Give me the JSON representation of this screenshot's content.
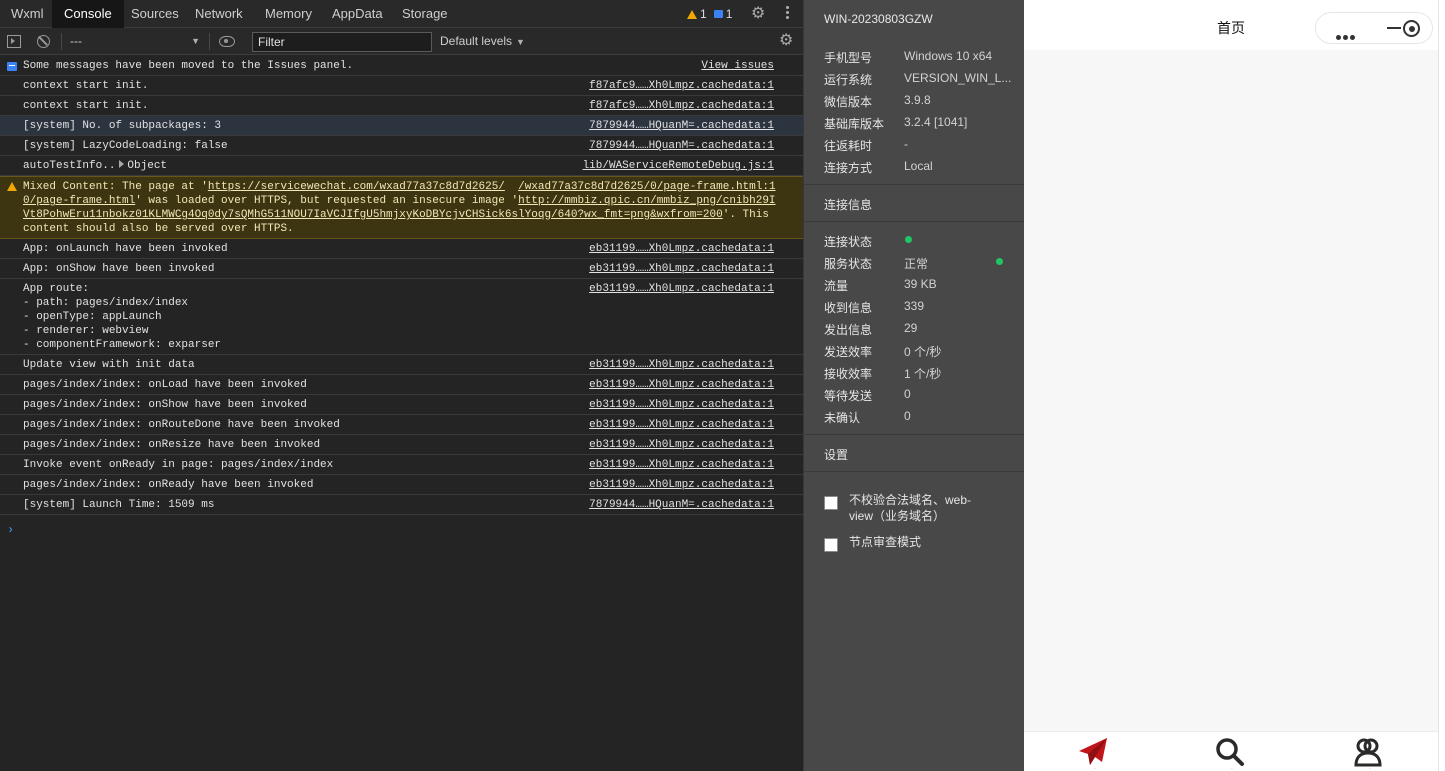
{
  "devtools": {
    "tabs": [
      "Wxml",
      "Console",
      "Sources",
      "Network",
      "Memory",
      "AppData",
      "Storage"
    ],
    "active_tab": "Console",
    "warning_count": "1",
    "message_count": "1",
    "toolbar": {
      "context": "---",
      "filter_placeholder": "Filter",
      "levels": "Default levels"
    },
    "console": {
      "issues_notice": "Some messages have been moved to the Issues panel.",
      "view_issues": "View issues",
      "rows": [
        {
          "text": "context start init.",
          "src": "f87afc9……Xh0Lmpz.cachedata:1"
        },
        {
          "text": "context start init.",
          "src": "f87afc9……Xh0Lmpz.cachedata:1"
        },
        {
          "text": "[system] No. of subpackages: 3",
          "src": "7879944……HQuanM=.cachedata:1"
        },
        {
          "text": "[system] LazyCodeLoading: false",
          "src": "7879944……HQuanM=.cachedata:1"
        },
        {
          "text": "autoTestInfo..",
          "obj": "Object",
          "src": "lib/WAServiceRemoteDebug.js:1"
        },
        {
          "text": "App: onLaunch have been invoked",
          "src": "eb31199……Xh0Lmpz.cachedata:1"
        },
        {
          "text": "App: onShow have been invoked",
          "src": "eb31199……Xh0Lmpz.cachedata:1"
        },
        {
          "text": "App route:\n- path: pages/index/index\n- openType: appLaunch\n- renderer: webview\n- componentFramework: exparser",
          "src": "eb31199……Xh0Lmpz.cachedata:1"
        },
        {
          "text": "Update view with init data",
          "src": "eb31199……Xh0Lmpz.cachedata:1"
        },
        {
          "text": "pages/index/index: onLoad have been invoked",
          "src": "eb31199……Xh0Lmpz.cachedata:1"
        },
        {
          "text": "pages/index/index: onShow have been invoked",
          "src": "eb31199……Xh0Lmpz.cachedata:1"
        },
        {
          "text": "pages/index/index: onRouteDone have been invoked",
          "src": "eb31199……Xh0Lmpz.cachedata:1"
        },
        {
          "text": "pages/index/index: onResize have been invoked",
          "src": "eb31199……Xh0Lmpz.cachedata:1"
        },
        {
          "text": "Invoke event onReady in page: pages/index/index",
          "src": "eb31199……Xh0Lmpz.cachedata:1"
        },
        {
          "text": "pages/index/index: onReady have been invoked",
          "src": "eb31199……Xh0Lmpz.cachedata:1"
        },
        {
          "text": "[system] Launch Time: 1509 ms",
          "src": "7879944……HQuanM=.cachedata:1"
        }
      ],
      "warning": {
        "a": "Mixed Content: The page at '",
        "url1": "https://servicewechat.com/wxad77a37c8d7d2625/",
        "gap": "  ",
        "src_line1": "/wxad77a37c8d7d2625/0/page-frame.html:1",
        "src_line2": "0/page-frame.html",
        "b": "' was loaded over HTTPS, but requested an insecure image '",
        "url2a": "http://mmbiz.qpic.cn/mmbiz_png/cnibh29I",
        "url2b": "Vt8PohwEru11nbokz01KLMWCg4Oq0dy7sQMhG511NOU7IaVCJIfgU5hmjxyKoDBYcjvCHSick6slYoqg/640?wx_fmt=png&wxfrom=200",
        "c": "'. This",
        "d": "content should also be served over HTTPS."
      }
    }
  },
  "debug_panel": {
    "device_name": "WIN-20230803GZW",
    "info": [
      {
        "label": "手机型号",
        "value": "Windows 10 x64"
      },
      {
        "label": "运行系统",
        "value": "VERSION_WIN_L..."
      },
      {
        "label": "微信版本",
        "value": "3.9.8"
      },
      {
        "label": "基础库版本",
        "value": "3.2.4 [1041]"
      },
      {
        "label": "往返耗时",
        "value": "-"
      },
      {
        "label": "连接方式",
        "value": "Local"
      }
    ],
    "connection_section": "连接信息",
    "stats": [
      {
        "label": "连接状态",
        "value": ""
      },
      {
        "label": "服务状态",
        "value": "正常"
      },
      {
        "label": "流量",
        "value": "39 KB"
      },
      {
        "label": "收到信息",
        "value": "339"
      },
      {
        "label": "发出信息",
        "value": "29"
      },
      {
        "label": "发送效率",
        "value": "0 个/秒"
      },
      {
        "label": "接收效率",
        "value": "1 个/秒"
      },
      {
        "label": "等待发送",
        "value": "0"
      },
      {
        "label": "未确认",
        "value": "0"
      }
    ],
    "settings_section": "设置",
    "settings": [
      {
        "label": "不校验合法域名、web-view（业务域名）"
      },
      {
        "label": "节点审查模式"
      }
    ],
    "status_color": "#1ec761"
  },
  "simulator": {
    "title": "首页",
    "accent_color": "#c0151b",
    "tabbar": [
      {
        "icon": "paper-plane-icon",
        "label": "·"
      },
      {
        "icon": "search-icon",
        "label": "·"
      },
      {
        "icon": "user-icon",
        "label": "·"
      }
    ]
  }
}
